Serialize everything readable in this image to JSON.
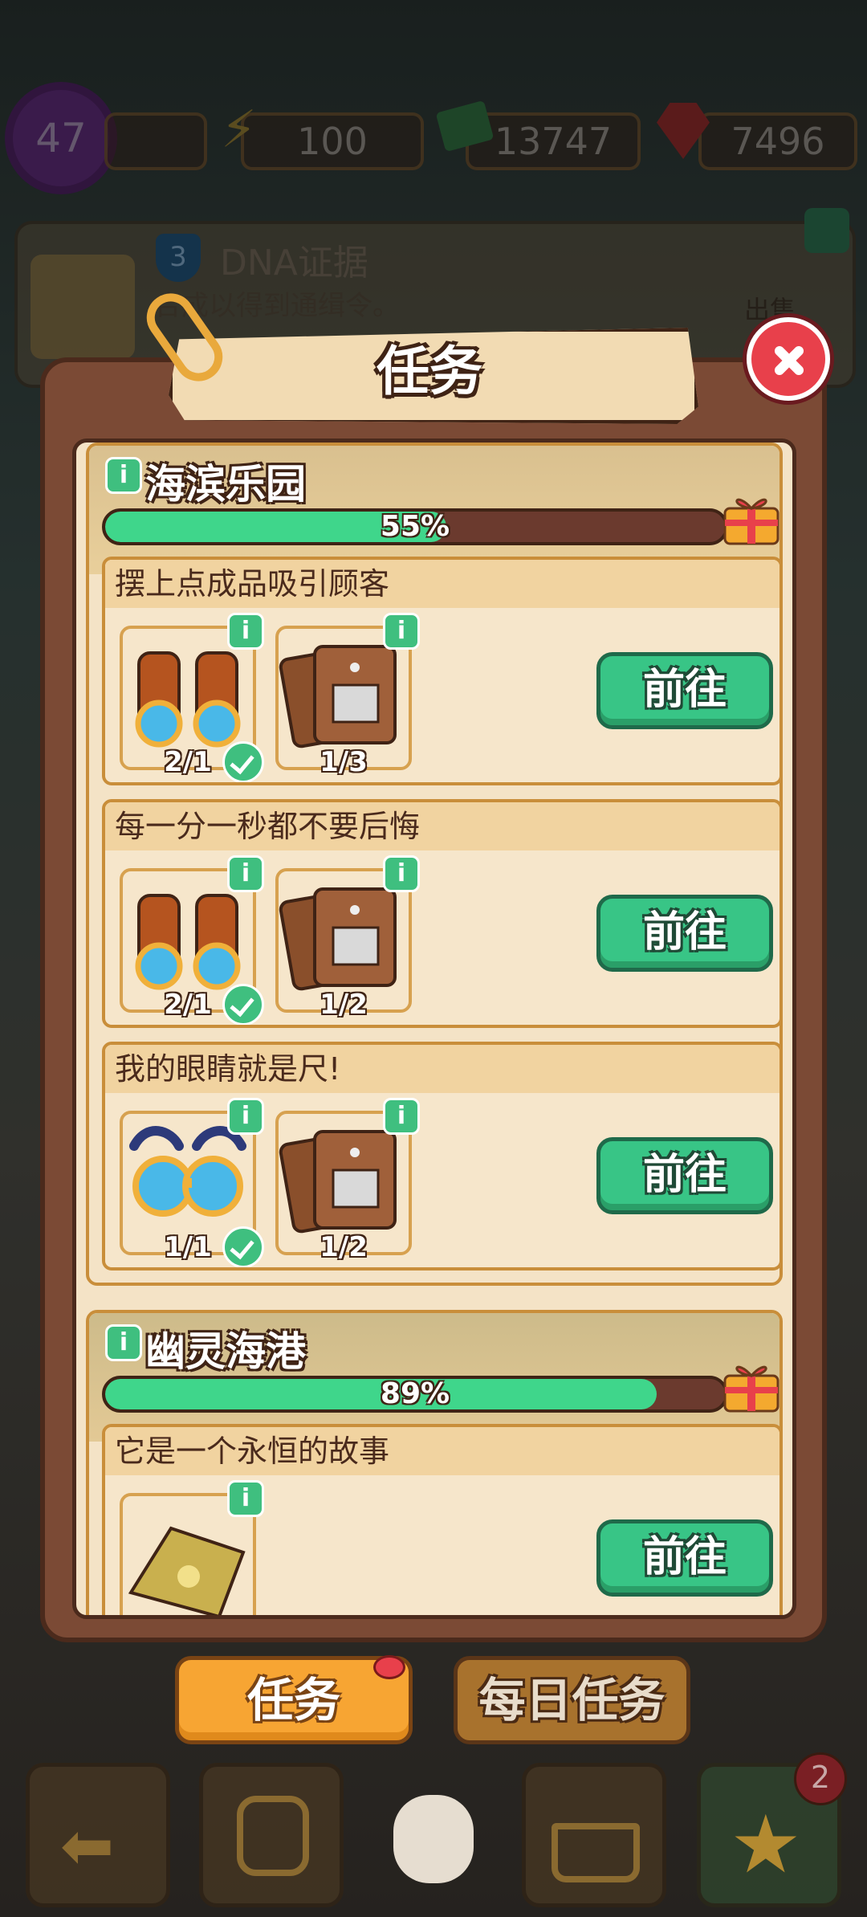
{
  "top_bar": {
    "level": "47",
    "energy": "100",
    "cash": "13747",
    "gems": "7496"
  },
  "background_card": {
    "badge_number": "3",
    "title": "DNA证据",
    "description": "合成以得到通缉令。",
    "sell_label": "出售"
  },
  "popup": {
    "title": "任务",
    "sections": [
      {
        "title": "海滨乐园",
        "progress_text": "55%",
        "progress": 0.55,
        "tasks": [
          {
            "name": "摆上点成品吸引顾客",
            "items": [
              {
                "icon": "binoculars-icon",
                "count": "2/1",
                "done": true
              },
              {
                "icon": "brown-bag-icon",
                "count": "1/3",
                "done": false
              }
            ],
            "button": "前往"
          },
          {
            "name": "每一分一秒都不要后悔",
            "items": [
              {
                "icon": "binoculars-icon",
                "count": "2/1",
                "done": true
              },
              {
                "icon": "brown-bag-icon",
                "count": "1/2",
                "done": false
              }
            ],
            "button": "前往"
          },
          {
            "name": "我的眼睛就是尺!",
            "items": [
              {
                "icon": "sunglasses-icon",
                "count": "1/1",
                "done": true
              },
              {
                "icon": "brown-bag-icon",
                "count": "1/2",
                "done": false
              }
            ],
            "button": "前往"
          }
        ]
      },
      {
        "title": "幽灵海港",
        "progress_text": "89%",
        "progress": 0.89,
        "tasks": [
          {
            "name": "它是一个永恒的故事",
            "items": [
              {
                "icon": "yellow-cloth-icon",
                "count": "",
                "done": false
              }
            ],
            "button": "前往"
          }
        ]
      }
    ]
  },
  "tabs": {
    "tasks": "任务",
    "daily": "每日任务"
  },
  "nav": {
    "badge_count": "2"
  },
  "colors": {
    "accent_green": "#38c586",
    "tab_active": "#f7a533",
    "close_red": "#e8404b"
  }
}
